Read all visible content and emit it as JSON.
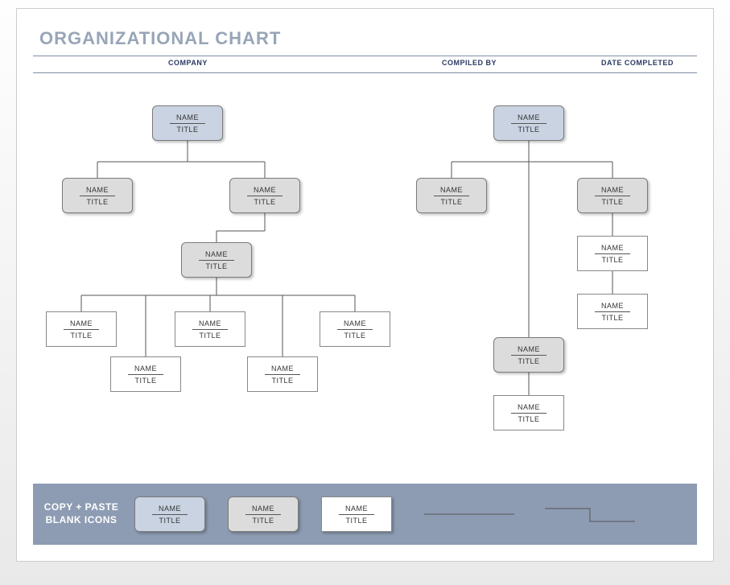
{
  "title": "ORGANIZATIONAL CHART",
  "headers": {
    "company": "COMPANY",
    "compiledBy": "COMPILED BY",
    "dateCompleted": "DATE COMPLETED"
  },
  "labels": {
    "name": "NAME",
    "title": "TITLE"
  },
  "footer": {
    "copyPaste": "COPY + PASTE\nBLANK ICONS"
  },
  "chart_data": {
    "type": "table",
    "description": "Organizational chart template with two parallel hierarchies. All nodes are blank placeholders labeled NAME / TITLE.",
    "trees": [
      {
        "root": {
          "name": "NAME",
          "title": "TITLE",
          "style": "blue"
        },
        "children": [
          {
            "name": "NAME",
            "title": "TITLE",
            "style": "gray"
          },
          {
            "name": "NAME",
            "title": "TITLE",
            "style": "gray",
            "children": [
              {
                "name": "NAME",
                "title": "TITLE",
                "style": "gray",
                "children": [
                  {
                    "name": "NAME",
                    "title": "TITLE",
                    "style": "white"
                  },
                  {
                    "name": "NAME",
                    "title": "TITLE",
                    "style": "white"
                  },
                  {
                    "name": "NAME",
                    "title": "TITLE",
                    "style": "white"
                  },
                  {
                    "name": "NAME",
                    "title": "TITLE",
                    "style": "white"
                  },
                  {
                    "name": "NAME",
                    "title": "TITLE",
                    "style": "white"
                  }
                ]
              }
            ]
          }
        ]
      },
      {
        "root": {
          "name": "NAME",
          "title": "TITLE",
          "style": "blue"
        },
        "children": [
          {
            "name": "NAME",
            "title": "TITLE",
            "style": "gray"
          },
          {
            "name": "NAME",
            "title": "TITLE",
            "style": "gray",
            "children": [
              {
                "name": "NAME",
                "title": "TITLE",
                "style": "gray",
                "children": [
                  {
                    "name": "NAME",
                    "title": "TITLE",
                    "style": "white"
                  }
                ]
              }
            ]
          },
          {
            "name": "NAME",
            "title": "TITLE",
            "style": "gray",
            "children": [
              {
                "name": "NAME",
                "title": "TITLE",
                "style": "white"
              },
              {
                "name": "NAME",
                "title": "TITLE",
                "style": "white"
              }
            ]
          }
        ]
      }
    ]
  }
}
